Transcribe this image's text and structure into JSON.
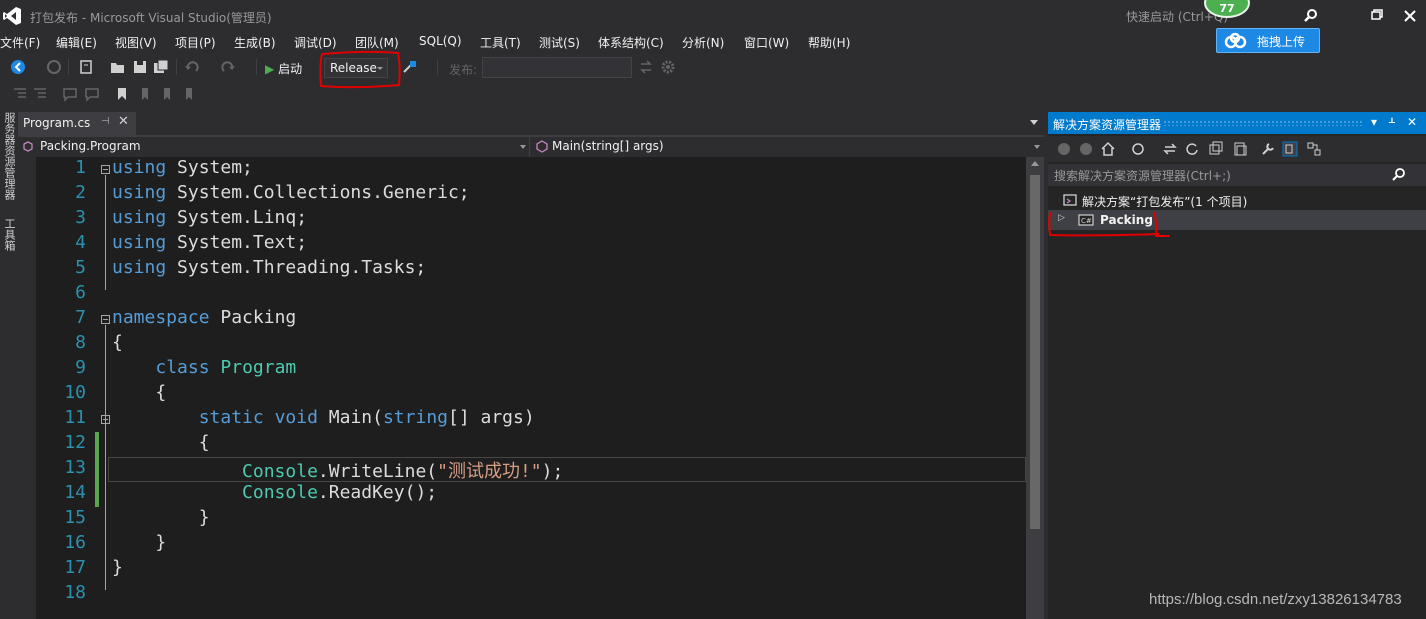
{
  "window": {
    "title": "打包发布 - Microsoft Visual Studio(管理员)",
    "quick_launch_placeholder": "快速启动 (Ctrl+Q)",
    "badge_count": "77",
    "upload_button_label": "拖拽上传"
  },
  "menu": {
    "items": [
      "文件(F)",
      "编辑(E)",
      "视图(V)",
      "项目(P)",
      "生成(B)",
      "调试(D)",
      "团队(M)",
      "SQL(Q)",
      "工具(T)",
      "测试(S)",
      "体系结构(C)",
      "分析(N)",
      "窗口(W)",
      "帮助(H)"
    ]
  },
  "toolbar": {
    "start_label": "启动",
    "configuration_value": "Release",
    "publish_label": "发布:",
    "publish_value": ""
  },
  "side_tabs": {
    "server_explorer": "服务器资源管理器",
    "toolbox": "工具箱"
  },
  "editor": {
    "tab_label": "Program.cs",
    "nav_left": "Packing.Program",
    "nav_right": "Main(string[] args)",
    "lines": [
      {
        "n": "1",
        "parts": [
          [
            "kw",
            "using"
          ],
          [
            "tx",
            " System;"
          ]
        ]
      },
      {
        "n": "2",
        "parts": [
          [
            "kw",
            "using"
          ],
          [
            "tx",
            " System.Collections.Generic;"
          ]
        ]
      },
      {
        "n": "3",
        "parts": [
          [
            "kw",
            "using"
          ],
          [
            "tx",
            " System.Linq;"
          ]
        ]
      },
      {
        "n": "4",
        "parts": [
          [
            "kw",
            "using"
          ],
          [
            "tx",
            " System.Text;"
          ]
        ]
      },
      {
        "n": "5",
        "parts": [
          [
            "kw",
            "using"
          ],
          [
            "tx",
            " System.Threading.Tasks;"
          ]
        ]
      },
      {
        "n": "6",
        "parts": []
      },
      {
        "n": "7",
        "parts": [
          [
            "kw",
            "namespace"
          ],
          [
            "tx",
            " Packing"
          ]
        ]
      },
      {
        "n": "8",
        "parts": [
          [
            "tx",
            "{"
          ]
        ]
      },
      {
        "n": "9",
        "parts": [
          [
            "tx",
            "    "
          ],
          [
            "kw",
            "class"
          ],
          [
            "tx",
            " "
          ],
          [
            "ty",
            "Program"
          ]
        ]
      },
      {
        "n": "10",
        "parts": [
          [
            "tx",
            "    {"
          ]
        ]
      },
      {
        "n": "11",
        "parts": [
          [
            "tx",
            "        "
          ],
          [
            "kw",
            "static"
          ],
          [
            "tx",
            " "
          ],
          [
            "kw",
            "void"
          ],
          [
            "tx",
            " Main("
          ],
          [
            "kw",
            "string"
          ],
          [
            "tx",
            "[] args)"
          ]
        ]
      },
      {
        "n": "12",
        "parts": [
          [
            "tx",
            "        {"
          ]
        ]
      },
      {
        "n": "13",
        "parts": [
          [
            "tx",
            "            "
          ],
          [
            "ty",
            "Console"
          ],
          [
            "tx",
            ".WriteLine("
          ],
          [
            "st",
            "\"测试成功!\""
          ],
          [
            "tx",
            ");"
          ]
        ]
      },
      {
        "n": "14",
        "parts": [
          [
            "tx",
            "            "
          ],
          [
            "ty",
            "Console"
          ],
          [
            "tx",
            ".ReadKey();"
          ]
        ]
      },
      {
        "n": "15",
        "parts": [
          [
            "tx",
            "        }"
          ]
        ]
      },
      {
        "n": "16",
        "parts": [
          [
            "tx",
            "    }"
          ]
        ]
      },
      {
        "n": "17",
        "parts": [
          [
            "tx",
            "}"
          ]
        ]
      },
      {
        "n": "18",
        "parts": []
      }
    ]
  },
  "solution_explorer": {
    "title": "解决方案资源管理器",
    "search_placeholder": "搜索解决方案资源管理器(Ctrl+;)",
    "solution_label": "解决方案“打包发布”(1 个项目)",
    "project_label": "Packing"
  },
  "watermark": "https://blog.csdn.net/zxy13826134783",
  "colors": {
    "accent": "#007acc",
    "keyword": "#569cd6",
    "type": "#4ec9b0",
    "string": "#d69d85",
    "line_number": "#2b91af",
    "annotation": "#e00000"
  }
}
